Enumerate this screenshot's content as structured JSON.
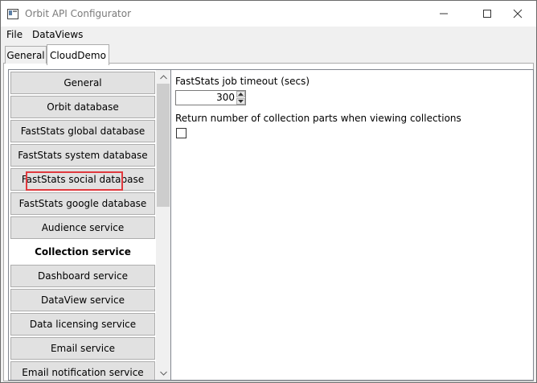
{
  "window": {
    "title": "Orbit API Configurator",
    "icon": "app-window-icon"
  },
  "menu": {
    "file": "File",
    "dataviews": "DataViews"
  },
  "tabs": [
    {
      "label": "General",
      "selected": false
    },
    {
      "label": "CloudDemo",
      "selected": true
    }
  ],
  "sidebar": {
    "items": [
      {
        "label": "General"
      },
      {
        "label": "Orbit database"
      },
      {
        "label": "FastStats global database"
      },
      {
        "label": "FastStats system database"
      },
      {
        "label": "FastStats social database"
      },
      {
        "label": "FastStats google database"
      },
      {
        "label": "Audience service"
      },
      {
        "label": "Collection service",
        "selected": true
      },
      {
        "label": "Dashboard service"
      },
      {
        "label": "DataView service"
      },
      {
        "label": "Data licensing service"
      },
      {
        "label": "Email service"
      },
      {
        "label": "Email notification service"
      }
    ]
  },
  "settings": {
    "timeout_label": "FastStats job timeout (secs)",
    "timeout_value": "300",
    "collection_parts_label": "Return number of collection parts when viewing collections",
    "collection_parts_checked": false
  },
  "colors": {
    "highlight": "#e0393e",
    "button_face": "#e1e1e1"
  }
}
